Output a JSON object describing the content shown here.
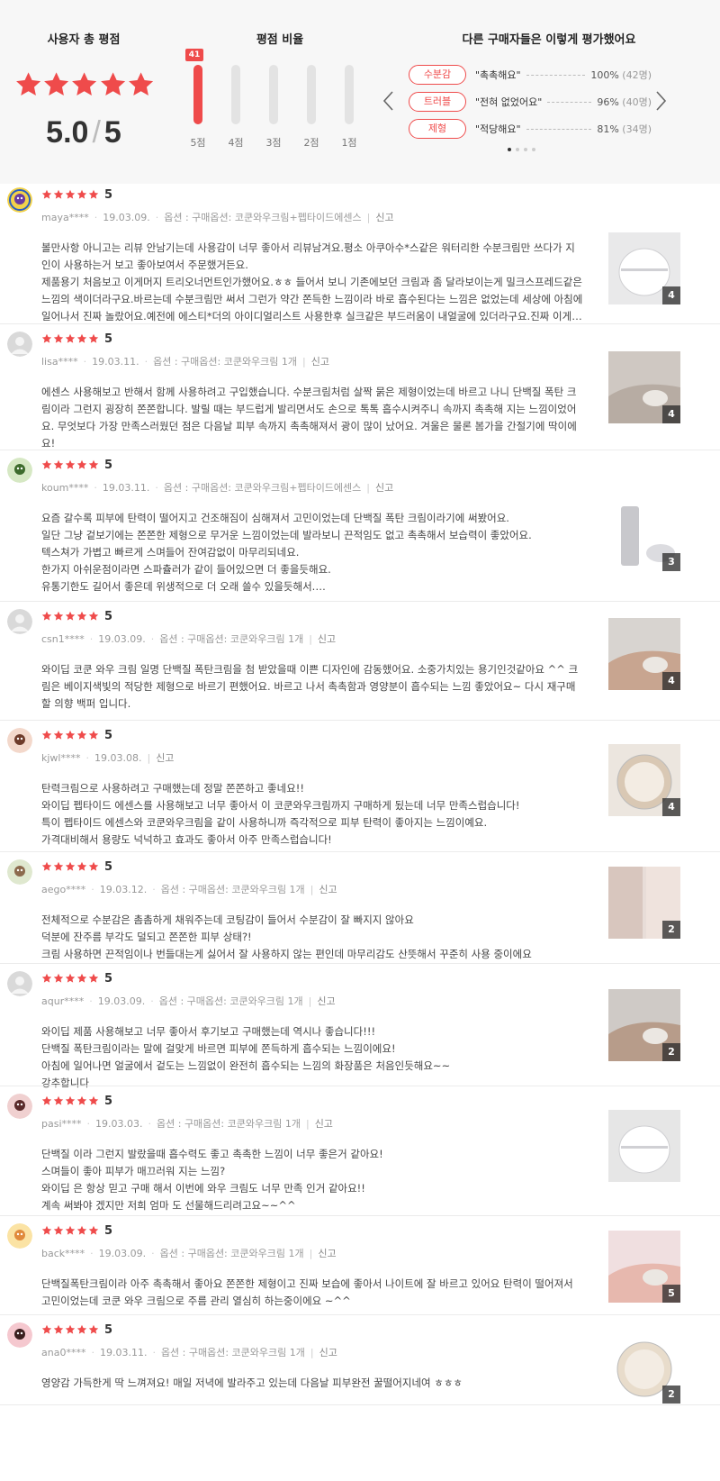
{
  "summary": {
    "total_title": "사용자 총 평점",
    "ratio_title": "평점 비율",
    "other_title": "다른 구매자들은 이렇게 평가했어요",
    "score": "5.0",
    "score_max": "5",
    "stars": 5,
    "bars": [
      {
        "label": "5점",
        "fraction": 1.0,
        "badge": "41"
      },
      {
        "label": "4점",
        "fraction": 0.0,
        "badge": ""
      },
      {
        "label": "3점",
        "fraction": 0.0,
        "badge": ""
      },
      {
        "label": "2점",
        "fraction": 0.0,
        "badge": ""
      },
      {
        "label": "1점",
        "fraction": 0.0,
        "badge": ""
      }
    ],
    "attributes": [
      {
        "tag": "수분감",
        "quote": "\"촉촉해요\"",
        "percent": "100%",
        "count": "(42명)"
      },
      {
        "tag": "트러블",
        "quote": "\"전혀 없었어요\"",
        "percent": "96%",
        "count": "(40명)"
      },
      {
        "tag": "제형",
        "quote": "\"적당해요\"",
        "percent": "81%",
        "count": "(34명)"
      }
    ],
    "carousel_pages": 4,
    "carousel_active": 1
  },
  "colors": {
    "accent": "#ef4b4b",
    "bar_track": "#e3e3e3",
    "summary_bg": "#f7f7f7"
  },
  "reviews": [
    {
      "user": "maya****",
      "score": "5",
      "date": "19.03.09.",
      "option": "옵션 : 구매옵션: 코쿤와우크림+펩타이드에센스",
      "report": "신고",
      "photo_count": "4",
      "lines": [
        "볼만사항 아니고는 리뷰 안남기는데 사용감이 너무 좋아서  리뷰남겨요.평소 아쿠아수*스같은 워터리한 수분크림만 쓰다가 지",
        "인이 사용하는거 보고 좋아보여서 주문했거든요.",
        "제품용기 처음보고 이게머지 트리오너먼트인가했어요.ㅎㅎ 들어서 보니 기존에보던 크림과 좀 달라보이는게 밀크스프레드같은",
        "느낌의 색이더라구요.바르는데 수분크림만 써서 그런가 약간 쫀득한 느낌이라 바로 흡수된다는 느낌은 없었는데 세상에 아침에",
        "일어나서 진짜 놀랐어요.예전에 에스티*더의 아이디얼리스트 사용한후 실크같은 부드러움이 내얼굴에 있더라구요.진짜 이게…"
      ]
    },
    {
      "user": "lisa****",
      "score": "5",
      "date": "19.03.11.",
      "option": "옵션 : 구매옵션: 코쿤와우크림 1개",
      "report": "신고",
      "photo_count": "4",
      "lines": [
        "에센스 사용해보고 반해서 함께 사용하려고 구입했습니다. 수분크림처럼 살짝 묽은 제형이었는데 바르고 나니 단백질 폭탄 크",
        "림이라 그런지 굉장히 쫀쫀합니다. 발릴 때는 부드럽게 발리면서도 손으로 톡톡 흡수시켜주니 속까지 촉촉해 지는 느낌이었어",
        "요. 무엇보다 가장 만족스러웠던 점은 다음날 피부 속까지 촉촉해져서 광이 많이 났어요. 겨울은 물론 봄가을 간절기에 딱이에",
        "요!"
      ]
    },
    {
      "user": "koum****",
      "score": "5",
      "date": "19.03.11.",
      "option": "옵션 : 구매옵션: 코쿤와우크림+펩타이드에센스",
      "report": "신고",
      "photo_count": "3",
      "lines": [
        "요즘 갈수록 피부에 탄력이 떨어지고 건조해짐이 심해져서 고민이었는데 단백질 폭탄 크림이라기에 써봤어요.",
        "일단  그냥 겉보기에는 쫀쫀한 제형으로 무거운 느낌이었는데 발라보니 끈적임도 없고 촉촉해서 보습력이 좋았어요.",
        "텍스쳐가 가볍고 빠르게 스며들어 잔여감없이 마무리되네요.",
        "한가지 아쉬운점이라면 스파츌러가 같이 들어있으면 더 좋을듯해요.",
        "유통기한도 길어서 좋은데 위생적으로 더 오래 쓸수 있을듯해서.…"
      ]
    },
    {
      "user": "csn1****",
      "score": "5",
      "date": "19.03.09.",
      "option": "옵션 : 구매옵션: 코쿤와우크림 1개",
      "report": "신고",
      "photo_count": "4",
      "lines": [
        "와이딥 코쿤 와우 크림 일명 단백질 폭탄크림을 첨 받았을때 이쁜 디자인에 감동했어요. 소중가치있는  용기인것같아요 ^^  크",
        "림은  베이지색빛의 적당한 제형으로 바르기 편했어요. 바르고 나서 촉촉함과 영양분이 흡수되는 느낌 좋았어요~ 다시 재구매",
        "할 의향 백퍼 입니다."
      ]
    },
    {
      "user": "kjwl****",
      "score": "5",
      "date": "19.03.08.",
      "option": "",
      "report": "신고",
      "photo_count": "4",
      "lines": [
        "탄력크림으로 사용하려고 구매했는데 정말 쫀쫀하고 좋네요!!",
        "와이딥 펩타이드 에센스를 사용해보고 너무 좋아서 이 코쿤와우크림까지 구매하게 됬는데 너무 만족스럽습니다!",
        "특이 펩타이드 에센스와 코쿤와우크림을 같이 사용하니까 즉각적으로 피부 탄력이 좋아지는 느낌이예요.",
        "가격대비해서 용량도 넉넉하고 효과도 좋아서 아주 만족스럽습니다!"
      ]
    },
    {
      "user": "aego****",
      "score": "5",
      "date": "19.03.12.",
      "option": "옵션 : 구매옵션: 코쿤와우크림 1개",
      "report": "신고",
      "photo_count": "2",
      "lines": [
        "전체적으로 수분감은 촘촘하게 채워주는데 코팅감이 들어서 수분감이 잘 빠지지 않아요",
        "덕분에 잔주름 부각도 덜되고 쫀쫀한 피부 상태?!",
        "크림 사용하면 끈적임이나 번들대는게 싫어서 잘 사용하지 않는 편인데 마무리감도 산뜻해서 꾸준히 사용 중이에요"
      ]
    },
    {
      "user": "aqur****",
      "score": "5",
      "date": "19.03.09.",
      "option": "옵션 : 구매옵션: 코쿤와우크림 1개",
      "report": "신고",
      "photo_count": "2",
      "lines": [
        "와이딥 제품 사용해보고 너무 좋아서 후기보고 구매했는데 역시나 좋습니다!!!",
        "단백질 폭탄크림이라는 말에 걸맞게 바르면 피부에 쫀득하게 흡수되는 느낌이에요!",
        "아침에 일어나면 얼굴에서 겉도는 느낌없이 완전히 흡수되는 느낌의 화장품은 처음인듯해요~~",
        "강추합니다"
      ]
    },
    {
      "user": "pasi****",
      "score": "5",
      "date": "19.03.03.",
      "option": "옵션 : 구매옵션: 코쿤와우크림 1개",
      "report": "신고",
      "photo_count": "",
      "lines": [
        "단백질 이라 그런지 발랐을때 흡수력도 좋고 촉촉한 느낌이 너무 좋은거 같아요!",
        "스며들이 좋아 피부가 매끄러워 지는 느낌?",
        "와이딥 은 항상 믿고 구매 해서 이번에 와우 크림도 너무 만족 인거 같아요!!",
        "계속 써봐야 겠지만 저희 엄마 도 선물해드리려고요~~^^"
      ]
    },
    {
      "user": "back****",
      "score": "5",
      "date": "19.03.09.",
      "option": "옵션 : 구매옵션: 코쿤와우크림 1개",
      "report": "신고",
      "photo_count": "5",
      "lines": [
        "단백질폭탄크림이라 아주 촉촉해서 좋아요 쫀쫀한 제형이고 진짜 보습에 좋아서 나이트에 잘 바르고 있어요 탄력이 떨어져서",
        "고민이었는데 코쿤 와우 크림으로 주름 관리 열심히 하는중이에요 ~^^"
      ]
    },
    {
      "user": "ana0****",
      "score": "5",
      "date": "19.03.11.",
      "option": "옵션 : 구매옵션: 코쿤와우크림 1개",
      "report": "신고",
      "photo_count": "2",
      "lines": [
        "영양감 가득한게 딱 느껴져요! 매일 저녁에 발라주고 있는데 다음날 피부완전 꿀떨어지네여 ㅎㅎㅎ"
      ]
    }
  ]
}
